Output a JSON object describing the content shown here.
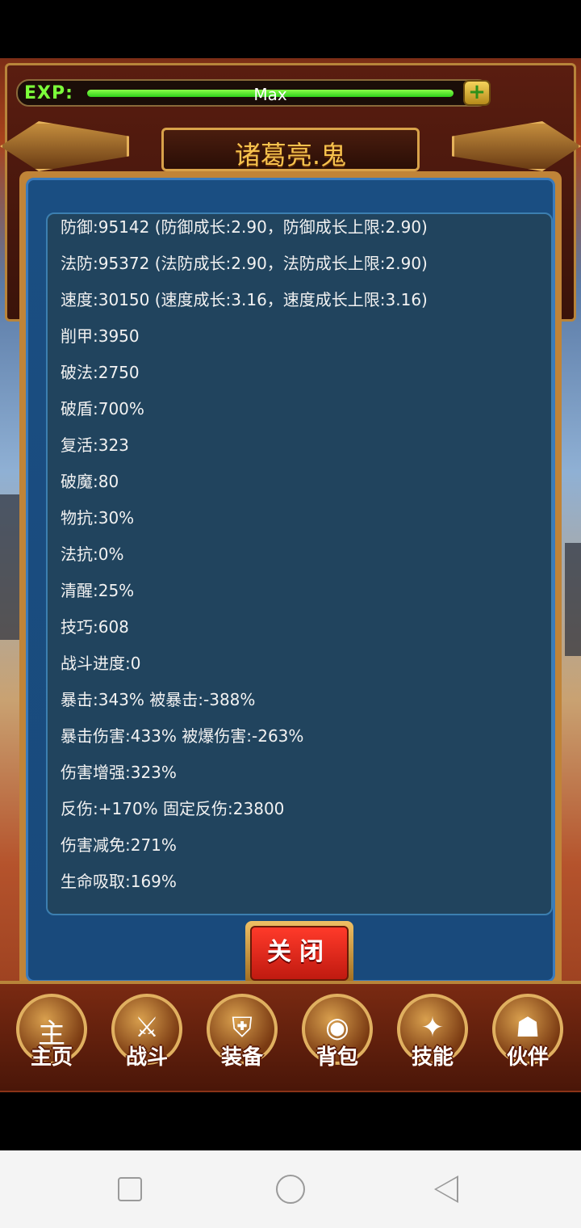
{
  "header": {
    "exp_label": "EXP:",
    "exp_value": "Max",
    "exp_progress": 1.0,
    "add_symbol": "+"
  },
  "dialog": {
    "title": "诸葛亮.鬼",
    "stats": [
      "防御:95142 (防御成长:2.90，防御成长上限:2.90)",
      "法防:95372 (法防成长:2.90，法防成长上限:2.90)",
      "速度:30150 (速度成长:3.16，速度成长上限:3.16)",
      "削甲:3950",
      "破法:2750",
      "破盾:700%",
      "复活:323",
      "破魔:80",
      "物抗:30%",
      "法抗:0%",
      "清醒:25%",
      "技巧:608",
      "战斗进度:0",
      "暴击:343% 被暴击:-388%",
      "暴击伤害:433% 被爆伤害:-263%",
      "伤害增强:323%",
      "反伤:+170% 固定反伤:23800",
      "伤害减免:271%",
      "生命吸取:169%"
    ],
    "close_label": "关闭"
  },
  "nav": {
    "items": [
      {
        "label": "主页",
        "icon": "home-icon",
        "symbol": "主"
      },
      {
        "label": "战斗",
        "icon": "battle-icon",
        "symbol": "⚔"
      },
      {
        "label": "装备",
        "icon": "equipment-icon",
        "symbol": "⛨"
      },
      {
        "label": "背包",
        "icon": "bag-icon",
        "symbol": "◉"
      },
      {
        "label": "技能",
        "icon": "skill-icon",
        "symbol": "✦"
      },
      {
        "label": "伙伴",
        "icon": "partner-icon",
        "symbol": "☗"
      }
    ]
  },
  "colors": {
    "accent_gold": "#f7c24d",
    "exp_green": "#7cff3a",
    "close_red": "#e02a1c"
  }
}
